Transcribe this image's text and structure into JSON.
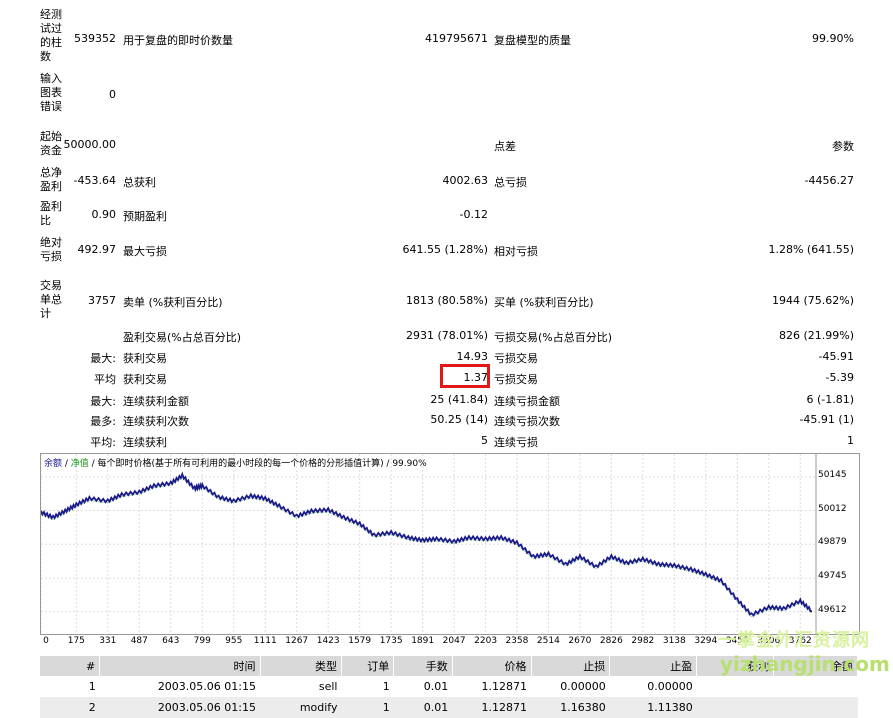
{
  "report": {
    "bars_tested_label": "经测试过的柱数",
    "bars_tested": "539352",
    "ticks_label": "用于复盘的即时价数量",
    "ticks": "419795671",
    "quality_label": "复盘模型的质量",
    "quality": "99.90%",
    "chart_errors_label": "输入图表错误",
    "chart_errors": "0",
    "deposit_label": "起始资金",
    "deposit": "50000.00",
    "spread_label": "点差",
    "params_label": "参数",
    "net_profit_label": "总净盈利",
    "net_profit": "-453.64",
    "gross_profit_label": "总获利",
    "gross_profit": "4002.63",
    "gross_loss_label": "总亏损",
    "gross_loss": "-4456.27",
    "profit_factor_label": "盈利比",
    "profit_factor": "0.90",
    "expected_payoff_label": "预期盈利",
    "expected_payoff": "-0.12",
    "abs_drawdown_label": "绝对亏损",
    "abs_drawdown": "492.97",
    "max_drawdown_label": "最大亏损",
    "max_drawdown": "641.55 (1.28%)",
    "rel_drawdown_label": "相对亏损",
    "rel_drawdown": "1.28% (641.55)",
    "total_trades_label": "交易单总计",
    "total_trades": "3757",
    "short_label": "卖单 (%获利百分比)",
    "short": "1813 (80.58%)",
    "long_label": "买单 (%获利百分比)",
    "long": "1944 (75.62%)",
    "profit_trades_label": "盈利交易(%占总百分比)",
    "profit_trades": "2931 (78.01%)",
    "loss_trades_label": "亏损交易(%占总百分比)",
    "loss_trades": "826 (21.99%)",
    "largest_label": "最大:",
    "largest_profit_label": "获利交易",
    "largest_profit": "14.93",
    "largest_loss_label": "亏损交易",
    "largest_loss": "-45.91",
    "average_label": "平均",
    "average_profit_label": "获利交易",
    "average_profit": "1.37",
    "average_loss_label": "亏损交易",
    "average_loss": "-5.39",
    "max_label": "最大:",
    "max_consec_wins_label": "连续获利金额",
    "max_consec_wins": "25 (41.84)",
    "max_consec_losses_label": "连续亏损金额",
    "max_consec_losses": "6 (-1.81)",
    "maximal_label": "最多:",
    "maximal_consec_profit_label": "连续获利次数",
    "maximal_consec_profit": "50.25 (14)",
    "maximal_consec_loss_label": "连续亏损次数",
    "maximal_consec_loss": "-45.91 (1)",
    "avg_label": "平均:",
    "avg_consec_wins_label": "连续获利",
    "avg_consec_wins": "5",
    "avg_consec_losses_label": "连续亏损",
    "avg_consec_losses": "1"
  },
  "chart_data": {
    "type": "line",
    "legend": {
      "balance": "余额",
      "sep1": " / ",
      "equity": "净值",
      "rest": " / 每个即时价格(基于所有可利用的最小时段的每一个价格的分形插值计算) / 99.90%"
    },
    "x_ticks": [
      "0",
      "175",
      "331",
      "487",
      "643",
      "799",
      "955",
      "1111",
      "1267",
      "1423",
      "1579",
      "1735",
      "1891",
      "2047",
      "2203",
      "2358",
      "2514",
      "2670",
      "2826",
      "2982",
      "3138",
      "3294",
      "3450",
      "3606",
      "3762"
    ],
    "y_ticks": [
      "50145",
      "50012",
      "49879",
      "49745",
      "49612"
    ],
    "xlim": [
      0,
      3840
    ],
    "ylim": [
      49540,
      50180
    ],
    "x": [
      0,
      60,
      120,
      175,
      240,
      331,
      400,
      487,
      560,
      643,
      700,
      760,
      799,
      880,
      955,
      1040,
      1111,
      1180,
      1267,
      1340,
      1423,
      1500,
      1579,
      1650,
      1735,
      1820,
      1891,
      1960,
      2047,
      2120,
      2203,
      2280,
      2358,
      2440,
      2514,
      2600,
      2670,
      2750,
      2826,
      2900,
      2982,
      3060,
      3138,
      3220,
      3294,
      3370,
      3450,
      3520,
      3606,
      3680,
      3762,
      3820
    ],
    "values": [
      50005,
      49985,
      50010,
      50035,
      50060,
      50050,
      50075,
      50085,
      50110,
      50120,
      50150,
      50100,
      50110,
      50065,
      50050,
      50070,
      50060,
      50030,
      49990,
      50010,
      50015,
      49985,
      49960,
      49915,
      49925,
      49905,
      49895,
      49900,
      49890,
      49905,
      49900,
      49905,
      49885,
      49830,
      49840,
      49800,
      49830,
      49790,
      49830,
      49805,
      49820,
      49800,
      49795,
      49780,
      49760,
      49735,
      49660,
      49600,
      49630,
      49625,
      49655,
      49615
    ]
  },
  "orders": {
    "headers": [
      "#",
      "时间",
      "类型",
      "订单",
      "手数",
      "价格",
      "止损",
      "止盈",
      "获利",
      "余额"
    ],
    "rows": [
      [
        "1",
        "2003.05.06 01:15",
        "sell",
        "1",
        "0.01",
        "1.12871",
        "0.00000",
        "0.00000",
        "",
        ""
      ],
      [
        "2",
        "2003.05.06 01:15",
        "modify",
        "1",
        "0.01",
        "1.12871",
        "1.16380",
        "1.11380",
        "",
        ""
      ]
    ]
  },
  "watermark": {
    "line1": "一掌金外汇资源网",
    "line2": "yizhangjin.com"
  }
}
